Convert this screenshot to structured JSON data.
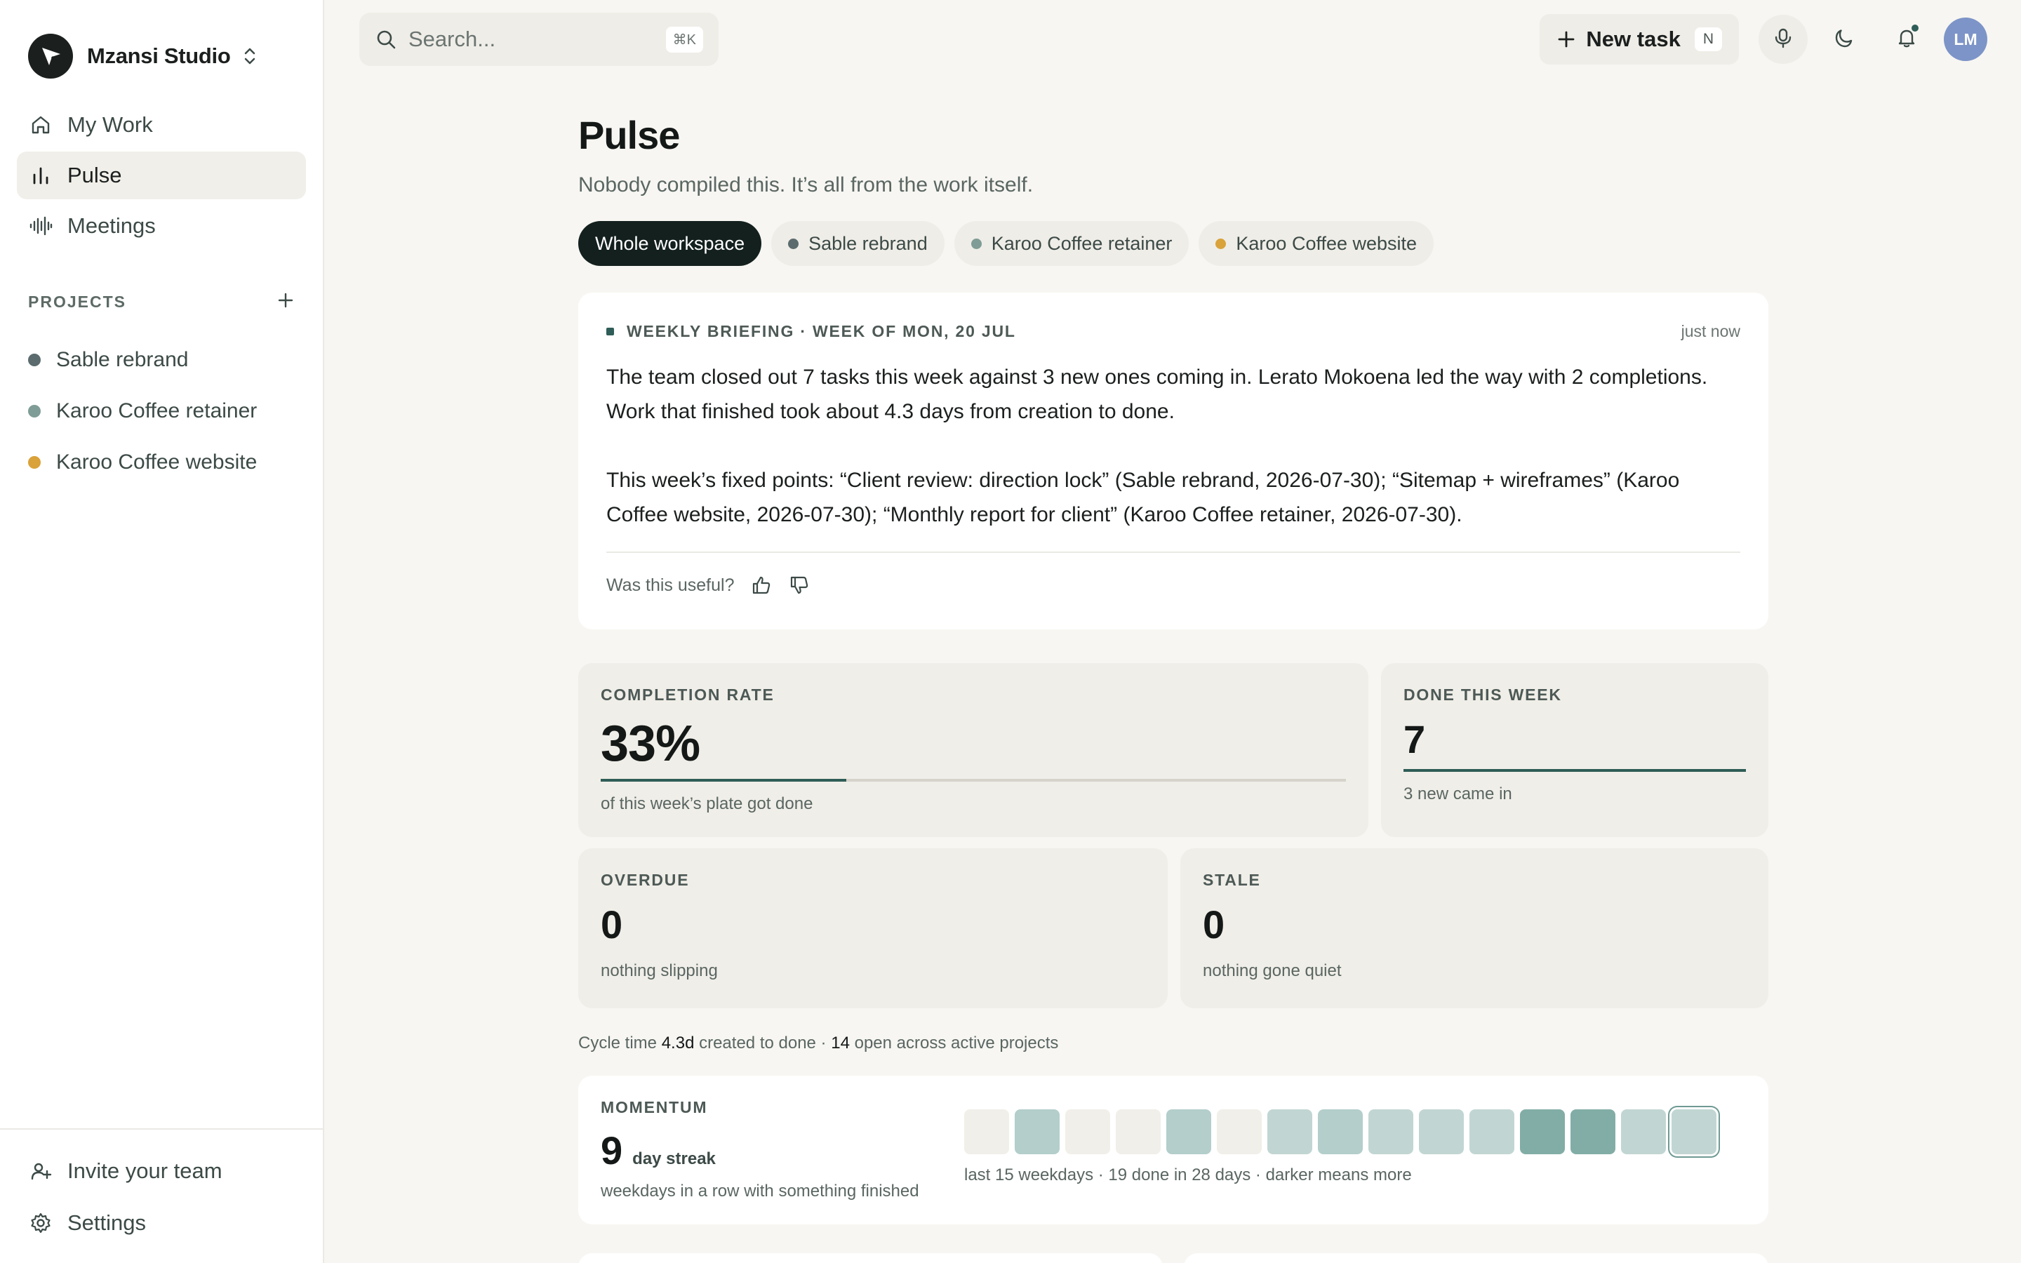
{
  "workspace": {
    "name": "Mzansi Studio"
  },
  "nav": [
    {
      "label": "My Work",
      "icon": "home-icon",
      "active": false
    },
    {
      "label": "Pulse",
      "icon": "bar-chart-icon",
      "active": true
    },
    {
      "label": "Meetings",
      "icon": "audio-wave-icon",
      "active": false
    }
  ],
  "projects": {
    "title": "PROJECTS",
    "items": [
      {
        "label": "Sable rebrand",
        "color": "#5b6b6e"
      },
      {
        "label": "Karoo Coffee retainer",
        "color": "#7f9c96"
      },
      {
        "label": "Karoo Coffee website",
        "color": "#d9a23a"
      }
    ]
  },
  "sidebar_bottom": {
    "invite": "Invite your team",
    "settings": "Settings"
  },
  "search": {
    "placeholder": "Search...",
    "shortcut": "⌘K"
  },
  "topbar": {
    "new_task": "New task",
    "new_task_shortcut": "N",
    "avatar_initials": "LM"
  },
  "page": {
    "title": "Pulse",
    "subtitle": "Nobody compiled this. It’s all from the work itself."
  },
  "filters": [
    {
      "label": "Whole workspace",
      "active": true,
      "color": null
    },
    {
      "label": "Sable rebrand",
      "active": false,
      "color": "#5b6b6e"
    },
    {
      "label": "Karoo Coffee retainer",
      "active": false,
      "color": "#7f9c96"
    },
    {
      "label": "Karoo Coffee website",
      "active": false,
      "color": "#d9a23a"
    }
  ],
  "briefing": {
    "label": "WEEKLY BRIEFING · WEEK OF MON, 20 JUL",
    "time": "just now",
    "paragraph1": "The team closed out 7 tasks this week against 3 new ones coming in. Lerato Mokoena led the way with 2 completions. Work that finished took about 4.3 days from creation to done.",
    "paragraph2": "This week’s fixed points: “Client review: direction lock” (Sable rebrand, 2026-07-30); “Sitemap + wireframes” (Karoo Coffee website, 2026-07-30); “Monthly report for client” (Karoo Coffee retainer, 2026-07-30).",
    "feedback_prompt": "Was this useful?"
  },
  "metrics": {
    "completion": {
      "label": "COMPLETION RATE",
      "value": "33%",
      "fraction": 0.33,
      "note": "of this week’s plate got done"
    },
    "done": {
      "label": "DONE THIS WEEK",
      "value": "7",
      "fraction": 1.0,
      "note": "3 new came in"
    },
    "overdue": {
      "label": "OVERDUE",
      "value": "0",
      "note": "nothing slipping"
    },
    "stale": {
      "label": "STALE",
      "value": "0",
      "note": "nothing gone quiet"
    }
  },
  "cycle": {
    "prefix": "Cycle time",
    "cycle_value": "4.3d",
    "middle": "created to done ·",
    "open_value": "14",
    "suffix": "open across active projects"
  },
  "momentum": {
    "label": "MOMENTUM",
    "streak": "9",
    "unit": "day streak",
    "sub": "weekdays in a row with something finished",
    "levels": [
      0,
      2,
      0,
      0,
      2,
      0,
      1,
      2,
      1,
      1,
      1,
      3,
      3,
      1,
      1
    ],
    "note": "last 15 weekdays · 19 done in 28 days · darker means more"
  },
  "colors": {
    "heat_0": "#f1efe9",
    "heat_1": "#c1d6d2",
    "heat_2": "#b3cecb",
    "heat_3": "#82ada6",
    "accent": "#2f5d57"
  }
}
